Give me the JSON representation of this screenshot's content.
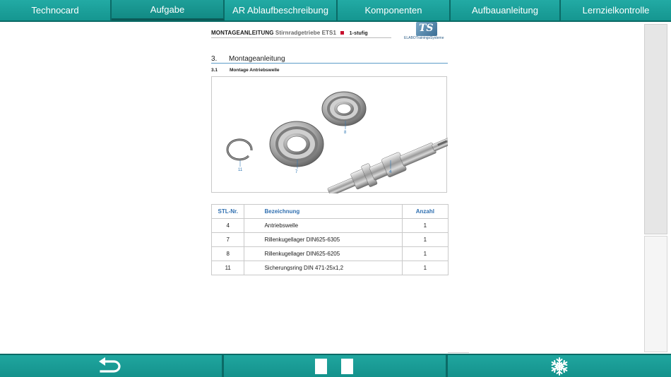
{
  "tabs": [
    {
      "label": "Technocard"
    },
    {
      "label": "Aufgabe"
    },
    {
      "label": "AR Ablaufbeschreibung"
    },
    {
      "label": "Komponenten"
    },
    {
      "label": "Aufbauanleitung"
    },
    {
      "label": "Lernzielkontrolle"
    }
  ],
  "active_tab": "Aufgabe",
  "document": {
    "header_title": "MONTAGEANLEITUNG",
    "header_subtitle": "Stirnradgetriebe ETS1",
    "header_variant": "1-stufig",
    "logo_mark": "TS",
    "logo_text": "ELABOTrainingsSysteme",
    "section_number": "3.",
    "section_title": "Montageanleitung",
    "subsection_number": "3.1",
    "subsection_title": "Montage Antriebswelle",
    "figure_callouts": {
      "c11": "11",
      "c7": "7",
      "c8": "8",
      "c4": "4"
    }
  },
  "parts_table": {
    "headers": {
      "nr": "STL-Nr.",
      "bez": "Bezeichnung",
      "anz": "Anzahl"
    },
    "rows": [
      {
        "nr": "4",
        "bez": "Antriebswelle",
        "anz": "1"
      },
      {
        "nr": "7",
        "bez": "Rillenkugellager DIN625-6305",
        "anz": "1"
      },
      {
        "nr": "8",
        "bez": "Rillenkugellager DIN625-6205",
        "anz": "1"
      },
      {
        "nr": "11",
        "bez": "Sicherungsring DIN 471-25x1,2",
        "anz": "1"
      }
    ]
  },
  "toolbar": {
    "back_icon": "back-arrow-icon",
    "pause_icon": "pause-icon",
    "freeze_icon": "snowflake-icon"
  },
  "colors": {
    "accent": "#1a9e98",
    "accent_dark": "#0b6a66",
    "link_blue": "#2f6fb0",
    "marker_red": "#c8102e"
  }
}
